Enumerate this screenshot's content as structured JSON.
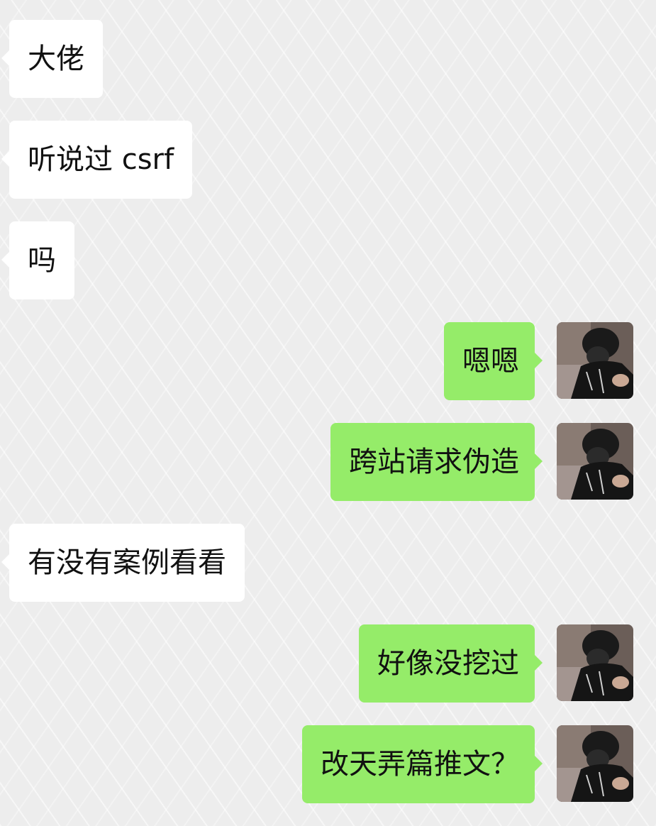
{
  "conversation": {
    "messages": [
      {
        "side": "left",
        "text": "大佬"
      },
      {
        "side": "left",
        "text": "听说过 csrf"
      },
      {
        "side": "left",
        "text": "吗"
      },
      {
        "side": "right",
        "text": "嗯嗯",
        "avatar": "user-avatar-photo"
      },
      {
        "side": "right",
        "text": "跨站请求伪造",
        "avatar": "user-avatar-photo"
      },
      {
        "side": "left",
        "text": "有没有案例看看"
      },
      {
        "side": "right",
        "text": "好像没挖过",
        "avatar": "user-avatar-photo"
      },
      {
        "side": "right",
        "text": "改天弄篇推文？",
        "avatar": "user-avatar-photo"
      }
    ]
  },
  "colors": {
    "chat_background": "#ededed",
    "incoming_bubble": "#ffffff",
    "outgoing_bubble": "#95ec69",
    "text": "#111111"
  }
}
